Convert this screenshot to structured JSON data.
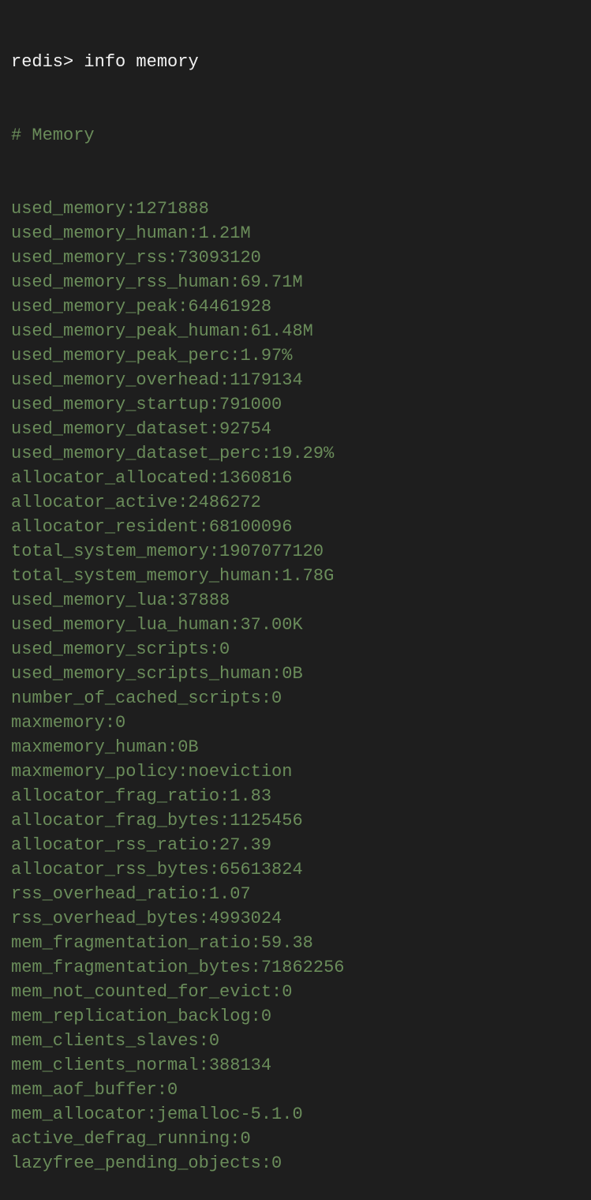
{
  "terminal": {
    "prompt": "redis>",
    "command": "info memory",
    "section_header": "# Memory",
    "lines": [
      "used_memory:1271888",
      "used_memory_human:1.21M",
      "used_memory_rss:73093120",
      "used_memory_rss_human:69.71M",
      "used_memory_peak:64461928",
      "used_memory_peak_human:61.48M",
      "used_memory_peak_perc:1.97%",
      "used_memory_overhead:1179134",
      "used_memory_startup:791000",
      "used_memory_dataset:92754",
      "used_memory_dataset_perc:19.29%",
      "allocator_allocated:1360816",
      "allocator_active:2486272",
      "allocator_resident:68100096",
      "total_system_memory:1907077120",
      "total_system_memory_human:1.78G",
      "used_memory_lua:37888",
      "used_memory_lua_human:37.00K",
      "used_memory_scripts:0",
      "used_memory_scripts_human:0B",
      "number_of_cached_scripts:0",
      "maxmemory:0",
      "maxmemory_human:0B",
      "maxmemory_policy:noeviction",
      "allocator_frag_ratio:1.83",
      "allocator_frag_bytes:1125456",
      "allocator_rss_ratio:27.39",
      "allocator_rss_bytes:65613824",
      "rss_overhead_ratio:1.07",
      "rss_overhead_bytes:4993024",
      "mem_fragmentation_ratio:59.38",
      "mem_fragmentation_bytes:71862256",
      "mem_not_counted_for_evict:0",
      "mem_replication_backlog:0",
      "mem_clients_slaves:0",
      "mem_clients_normal:388134",
      "mem_aof_buffer:0",
      "mem_allocator:jemalloc-5.1.0",
      "active_defrag_running:0",
      "lazyfree_pending_objects:0"
    ],
    "colors": {
      "background": "#1e1e1e",
      "prompt_text": "#f2f2f2",
      "output_text": "#6a8c5a"
    }
  }
}
